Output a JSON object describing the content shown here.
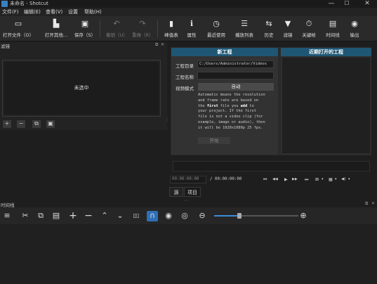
{
  "window": {
    "title": "未命名 - Shotcut",
    "min": "—",
    "max": "☐",
    "close": "✕"
  },
  "menu": [
    "文件(F)",
    "编辑(E)",
    "查看(V)",
    "设置",
    "帮助(H)"
  ],
  "toolbar": [
    {
      "label": "打开文件（O）",
      "icon": "open-file-icon",
      "glyph": "▭"
    },
    {
      "label": "打开其他...",
      "icon": "open-other-icon",
      "glyph": "▙"
    },
    {
      "label": "保存（S）",
      "icon": "save-icon",
      "glyph": "▣"
    },
    {
      "label": "撤销（U）",
      "icon": "undo-icon",
      "glyph": "↶",
      "disabled": true
    },
    {
      "label": "重做（R）",
      "icon": "redo-icon",
      "glyph": "↷",
      "disabled": true
    },
    {
      "label": "峰值表",
      "icon": "peak-meter-icon",
      "glyph": "▮"
    },
    {
      "label": "属性",
      "icon": "properties-icon",
      "glyph": "ℹ"
    },
    {
      "label": "最近使用",
      "icon": "recent-icon",
      "glyph": "◷"
    },
    {
      "label": "播放列表",
      "icon": "playlist-icon",
      "glyph": "☰"
    },
    {
      "label": "历史",
      "icon": "history-icon",
      "glyph": "⇆"
    },
    {
      "label": "滤镜",
      "icon": "filter-icon",
      "glyph": "▼"
    },
    {
      "label": "关键帧",
      "icon": "keyframe-icon",
      "glyph": "⏱"
    },
    {
      "label": "时间线",
      "icon": "timeline-icon",
      "glyph": "▤"
    },
    {
      "label": "输出",
      "icon": "export-icon",
      "glyph": "◉"
    }
  ],
  "filter_panel": {
    "title": "滤镜",
    "no_selection": "未选中",
    "buttons": [
      "+",
      "−",
      "⧉",
      "▣"
    ]
  },
  "new_project": {
    "header": "新工程",
    "dir_label": "工程目录",
    "dir_value": "C:/Users/Administrator/Videos",
    "name_label": "工程名称",
    "name_value": "",
    "mode_label": "视频模式",
    "mode_value": "自动",
    "desc_lines": [
      [
        "Automatic means the resolution"
      ],
      [
        "and frame rate are based on"
      ],
      [
        "the ",
        {
          "b": "first"
        },
        " file you ",
        {
          "b": "add"
        },
        " to"
      ],
      [
        "your project. If the first"
      ],
      [
        "file is not a video clip (for"
      ],
      [
        "example, image or audio), then"
      ],
      [
        "it will be 1920x1080p 25 fps."
      ]
    ],
    "start_button": "开始"
  },
  "recent_projects": {
    "header": "近期打开的工程"
  },
  "player": {
    "current_time": "00:00:00:00",
    "separator": "/",
    "total_time": "00:00:00:00",
    "transport": [
      "⏮",
      "◀◀",
      "▶",
      "▶▶",
      "⏭"
    ],
    "extra": [
      "⊠",
      "▾",
      "▦",
      "▾",
      "◀)",
      "▾"
    ]
  },
  "tabs": {
    "source": "源",
    "project": "项目"
  },
  "timeline": {
    "title": "时间线",
    "tools": [
      {
        "icon": "menu-icon",
        "glyph": "≡"
      },
      {
        "icon": "cut-icon",
        "glyph": "✂"
      },
      {
        "icon": "copy-icon",
        "glyph": "⧉"
      },
      {
        "icon": "paste-icon",
        "glyph": "▤"
      },
      {
        "icon": "append-icon",
        "glyph": "+"
      },
      {
        "icon": "remove-icon",
        "glyph": "−"
      },
      {
        "icon": "lift-icon",
        "glyph": "⌃"
      },
      {
        "icon": "overwrite-icon",
        "glyph": "⌄"
      },
      {
        "icon": "split-icon",
        "glyph": "▯▯"
      },
      {
        "icon": "snap-icon",
        "glyph": "∩",
        "active": true
      },
      {
        "icon": "scrub-icon",
        "glyph": "◉"
      },
      {
        "icon": "ripple-icon",
        "glyph": "◎"
      },
      {
        "icon": "zoom-out-icon",
        "glyph": "⊖"
      },
      {
        "icon": "zoom-in-icon",
        "glyph": "⊕"
      }
    ],
    "zoom_level": 0.3
  },
  "colors": {
    "accent": "#1f5674",
    "snap_active": "#2f6fb5",
    "zoom_fill": "#3a8bd8"
  }
}
